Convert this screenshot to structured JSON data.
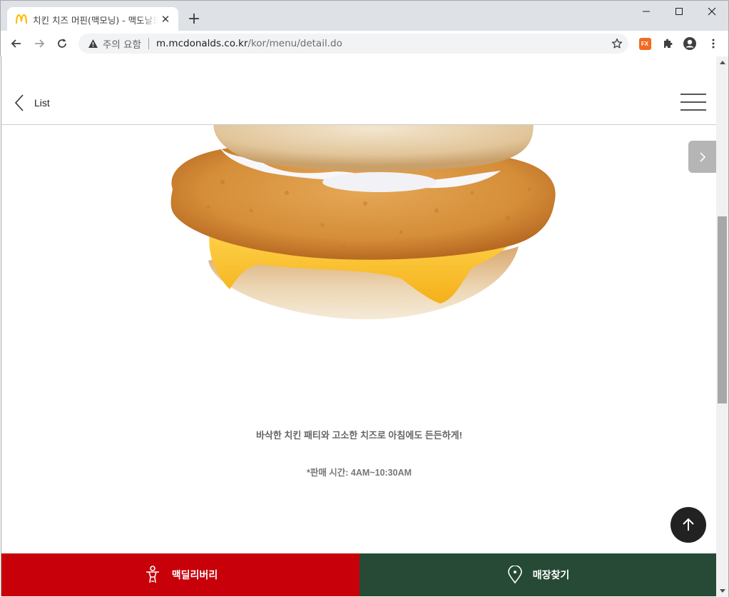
{
  "browser": {
    "tab_title": "치킨 치즈 머핀(맥모닝) - 맥도날드",
    "new_tab_label": "+",
    "security_label": "주의 요함",
    "url_host": "m.mcdonalds.co.kr",
    "url_path": "/kor/menu/detail.do",
    "extension_badge": "FX",
    "icons": {
      "back": "arrow-left-icon",
      "forward": "arrow-right-icon",
      "reload": "reload-icon",
      "warning": "warning-icon",
      "bookmark": "star-icon",
      "extensions": "puzzle-icon",
      "profile": "account-icon",
      "menu": "kebab-menu-icon"
    }
  },
  "header": {
    "back_label": "List"
  },
  "product": {
    "description": "바삭한 치킨 패티와 고소한 치즈로 아침에도 든든하게!",
    "sale_time": "*판매 시간: 4AM~10:30AM"
  },
  "bottom_bar": {
    "delivery_label": "맥딜리버리",
    "store_label": "매장찾기"
  },
  "colors": {
    "delivery": "#c8000a",
    "store": "#264a35",
    "brand_yellow": "#ffbc0d"
  }
}
